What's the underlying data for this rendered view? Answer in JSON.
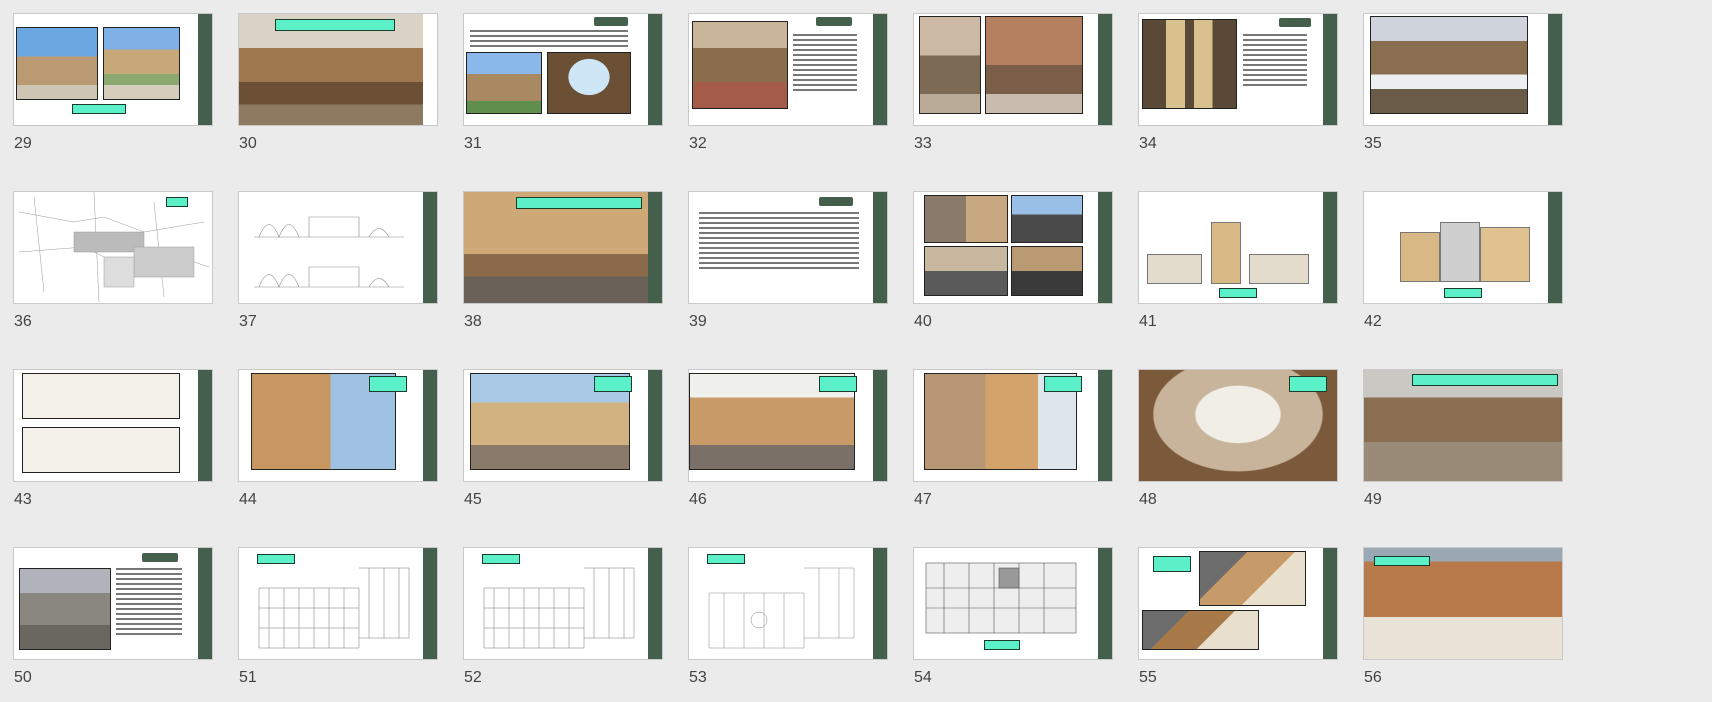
{
  "slides": [
    {
      "n": "29"
    },
    {
      "n": "30"
    },
    {
      "n": "31"
    },
    {
      "n": "32"
    },
    {
      "n": "33"
    },
    {
      "n": "34"
    },
    {
      "n": "35"
    },
    {
      "n": "36"
    },
    {
      "n": "37"
    },
    {
      "n": "38"
    },
    {
      "n": "39"
    },
    {
      "n": "40"
    },
    {
      "n": "41"
    },
    {
      "n": "42"
    },
    {
      "n": "43"
    },
    {
      "n": "44"
    },
    {
      "n": "45"
    },
    {
      "n": "46"
    },
    {
      "n": "47"
    },
    {
      "n": "48"
    },
    {
      "n": "49"
    },
    {
      "n": "50"
    },
    {
      "n": "51"
    },
    {
      "n": "52"
    },
    {
      "n": "53"
    },
    {
      "n": "54"
    },
    {
      "n": "55"
    },
    {
      "n": "56"
    }
  ],
  "colors": {
    "background": "#ebebeb",
    "slide_bar": "#44604d",
    "tag": "#5cf0c8",
    "number": "#444444"
  }
}
